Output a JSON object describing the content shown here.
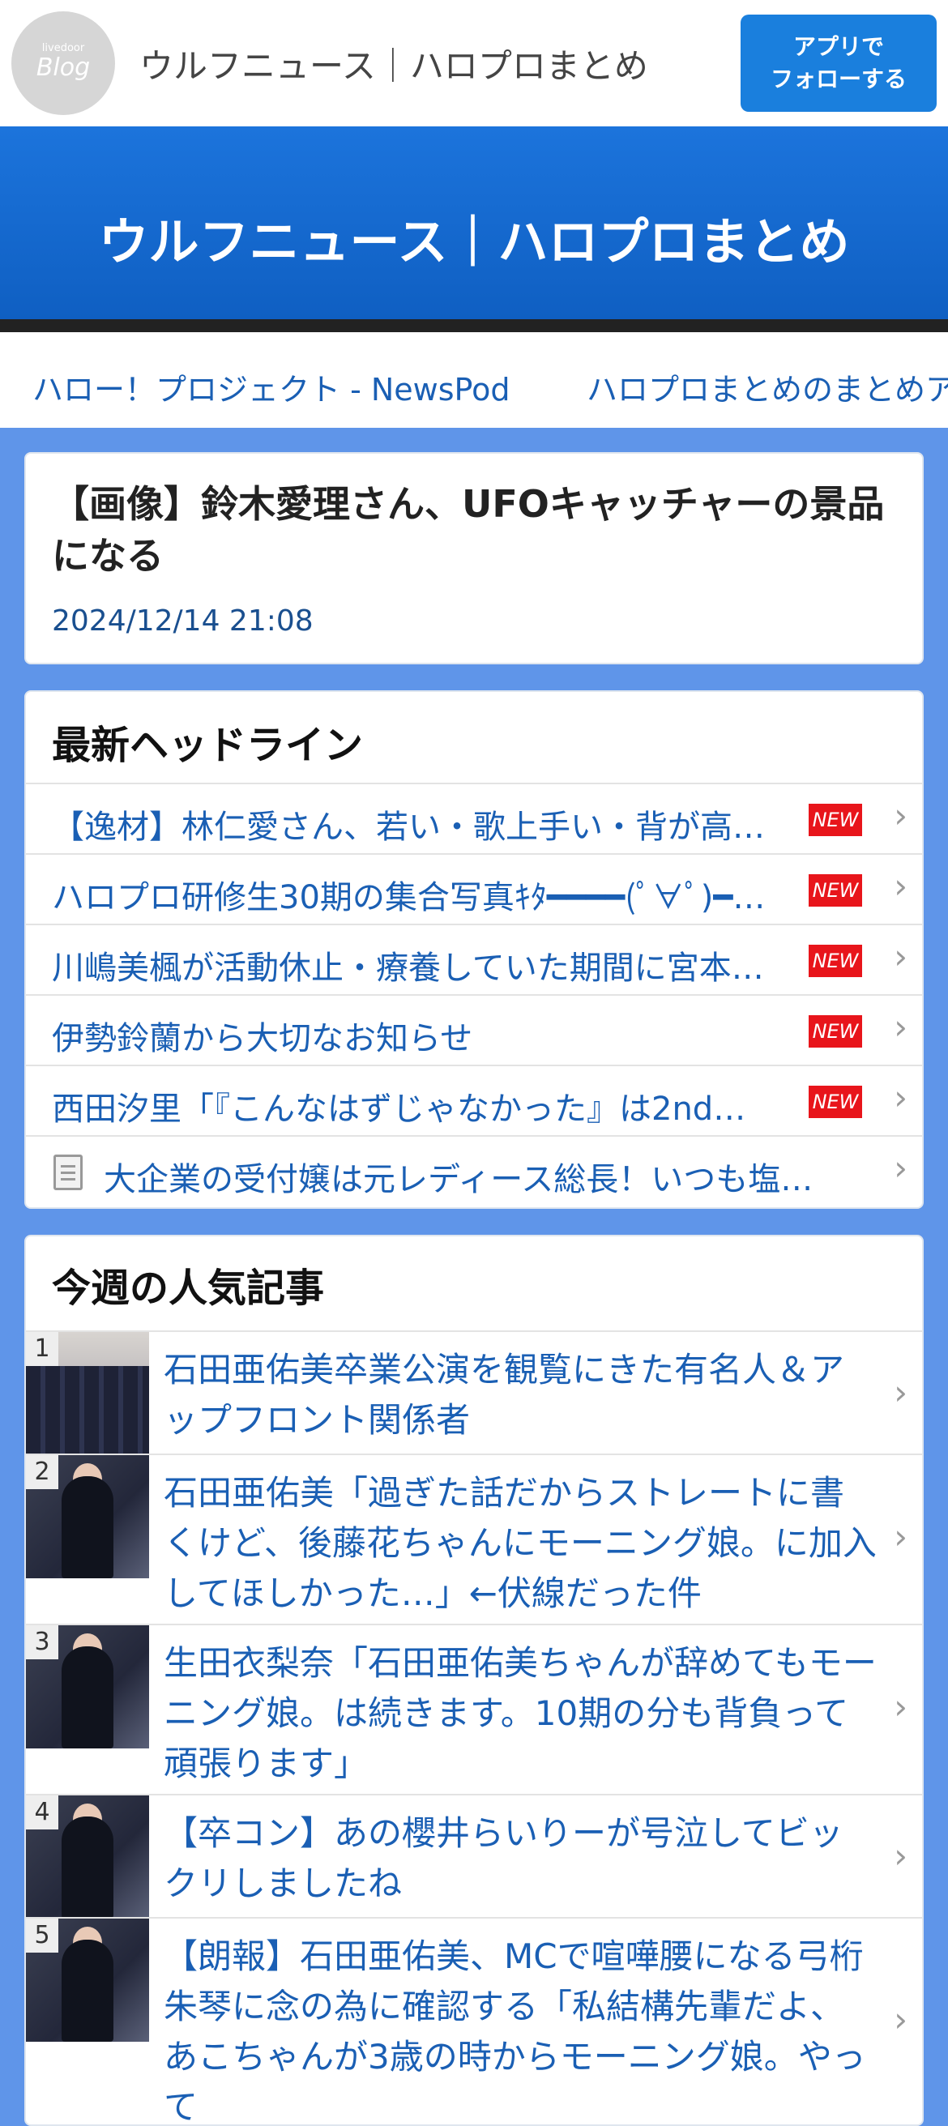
{
  "topbar": {
    "logo_small": "livedoor",
    "logo_big": "Blog",
    "site_title": "ウルフニュース｜ハロプロまとめ",
    "follow_line1": "アプリで",
    "follow_line2": "フォローする"
  },
  "banner": {
    "title": "ウルフニュース｜ハロプロまとめ"
  },
  "links": [
    "ハロー！プロジェクト - NewsPod",
    "ハロプロまとめのまとめア"
  ],
  "article": {
    "title": "【画像】鈴木愛理さん、UFOキャッチャーの景品になる",
    "date": "2024/12/14 21:08"
  },
  "headlines": {
    "heading": "最新ヘッドライン",
    "new_badge": "NEW",
    "items": [
      {
        "text": "【逸材】林仁愛さん、若い・歌上手い・背が高…",
        "new": true
      },
      {
        "text": "ハロプロ研修生30期の集合写真ｷﾀ━━━━(ﾟ∀ﾟ)━…",
        "new": true
      },
      {
        "text": "川嶋美楓が活動休止・療養していた期間に宮本…",
        "new": true
      },
      {
        "text": "伊勢鈴蘭から大切なお知らせ",
        "new": true
      },
      {
        "text": "西田汐里「『こんなはずじゃなかった』は2nd…",
        "new": true
      },
      {
        "text": "大企業の受付嬢は元レディース総長！いつも塩…",
        "new": false,
        "icon": "document-icon"
      }
    ]
  },
  "popular": {
    "heading": "今週の人気記事",
    "items": [
      {
        "rank": "1",
        "text": "石田亜佑美卒業公演を観覧にきた有名人＆アップフロント関係者"
      },
      {
        "rank": "2",
        "text": "石田亜佑美「過ぎた話だからストレートに書くけど、後藤花ちゃんにモーニング娘。に加入してほしかった…」←伏線だった件"
      },
      {
        "rank": "3",
        "text": "生田衣梨奈「石田亜佑美ちゃんが辞めてもモーニング娘。は続きます。10期の分も背負って頑張ります」"
      },
      {
        "rank": "4",
        "text": "【卒コン】あの櫻井らいりーが号泣してビックリしましたね"
      },
      {
        "rank": "5",
        "text": "【朗報】石田亜佑美、MCで喧嘩腰になる弓桁朱琴に念の為に確認する「私結構先輩だよ、あこちゃんが3歳の時からモーニング娘。やって"
      }
    ]
  },
  "colors": {
    "background": "#5f95e9",
    "banner": "#1c74dc",
    "link": "#1a5fb4",
    "new_badge": "#e8151b",
    "follow_button": "#1a7fdd"
  }
}
